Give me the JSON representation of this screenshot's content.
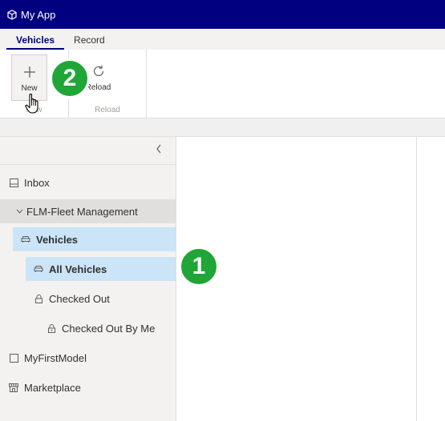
{
  "titlebar": {
    "app_icon": "cube-icon",
    "title": "My App"
  },
  "ribbon": {
    "tabs": [
      {
        "label": "Vehicles",
        "active": true
      },
      {
        "label": "Record",
        "active": false
      }
    ],
    "groups": [
      {
        "label": "New",
        "buttons": [
          {
            "label": "New",
            "icon": "plus-icon",
            "pressed": true
          }
        ]
      },
      {
        "label": "Reload",
        "buttons": [
          {
            "label": "Reload",
            "icon": "refresh-icon",
            "pressed": false
          }
        ]
      }
    ]
  },
  "nav": {
    "collapse_icon": "chevron-left-icon",
    "items": [
      {
        "label": "Inbox",
        "icon": "inbox-icon"
      },
      {
        "label": "FLM-Fleet Management",
        "icon": "chevron-down-icon",
        "type": "group"
      },
      {
        "label": "Vehicles",
        "icon": "car-icon",
        "state": "selected"
      },
      {
        "label": "All Vehicles",
        "icon": "car-icon",
        "state": "selected"
      },
      {
        "label": "Checked Out",
        "icon": "lock-icon"
      },
      {
        "label": "Checked Out By Me",
        "icon": "lock-icon"
      },
      {
        "label": "MyFirstModel",
        "icon": "square-icon"
      },
      {
        "label": "Marketplace",
        "icon": "store-icon"
      }
    ]
  },
  "callouts": [
    {
      "number": "1",
      "color": "#1fa637"
    },
    {
      "number": "2",
      "color": "#1fa637"
    }
  ],
  "colors": {
    "titlebar": "#000080",
    "selection": "#cce4f7",
    "badge": "#1fa637"
  }
}
